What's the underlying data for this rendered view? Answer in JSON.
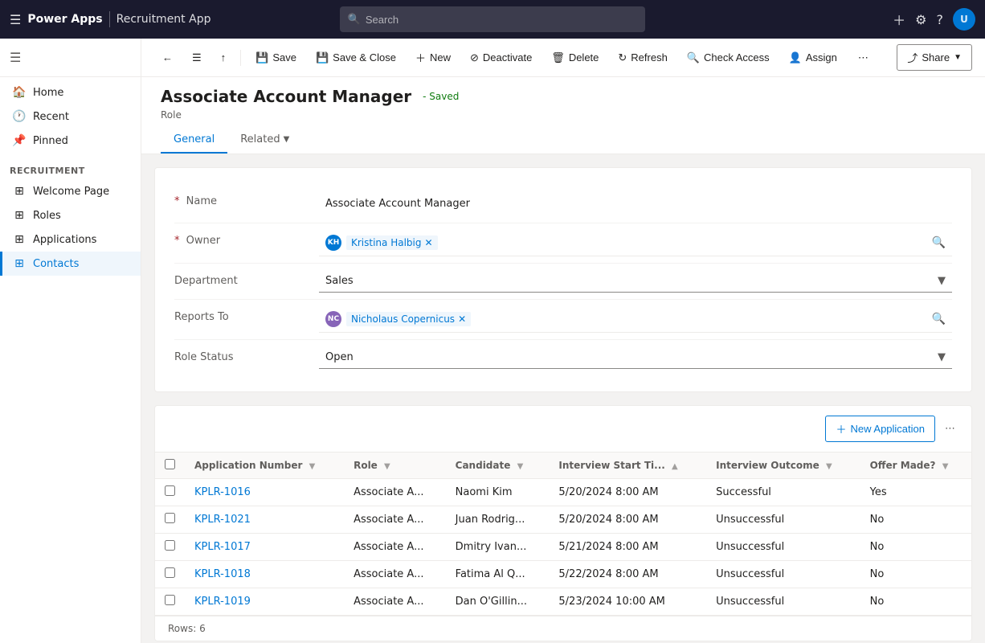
{
  "app": {
    "name": "Power Apps",
    "module": "Recruitment App"
  },
  "search": {
    "placeholder": "Search"
  },
  "topnav": {
    "icons": [
      "plus",
      "gear",
      "help",
      "user"
    ]
  },
  "sidebar": {
    "toggle_icon": "hamburger",
    "items": [
      {
        "id": "home",
        "label": "Home",
        "icon": "🏠",
        "active": false
      },
      {
        "id": "recent",
        "label": "Recent",
        "icon": "🕐",
        "active": false
      },
      {
        "id": "pinned",
        "label": "Pinned",
        "icon": "📌",
        "active": false
      },
      {
        "id": "recruitment",
        "label": "Recruitment",
        "icon": "",
        "group": true
      },
      {
        "id": "welcome-page",
        "label": "Welcome Page",
        "icon": "⊞",
        "active": false
      },
      {
        "id": "roles",
        "label": "Roles",
        "icon": "⊞",
        "active": false
      },
      {
        "id": "applications",
        "label": "Applications",
        "icon": "⊞",
        "active": false
      },
      {
        "id": "contacts",
        "label": "Contacts",
        "icon": "⊞",
        "active": true
      }
    ]
  },
  "commandbar": {
    "back_label": "",
    "toggle_label": "",
    "navigate_label": "",
    "save_label": "Save",
    "save_close_label": "Save & Close",
    "new_label": "New",
    "deactivate_label": "Deactivate",
    "delete_label": "Delete",
    "refresh_label": "Refresh",
    "check_access_label": "Check Access",
    "assign_label": "Assign",
    "more_label": "⋯",
    "share_label": "Share"
  },
  "record": {
    "title": "Associate Account Manager",
    "subtitle": "Role",
    "saved_text": "- Saved"
  },
  "tabs": {
    "general_label": "General",
    "related_label": "Related"
  },
  "form": {
    "name_label": "Name",
    "name_value": "Associate Account Manager",
    "owner_label": "Owner",
    "owner_value": "Kristina Halbig",
    "owner_initials": "KH",
    "department_label": "Department",
    "department_value": "Sales",
    "reports_to_label": "Reports To",
    "reports_to_value": "Nicholaus Copernicus",
    "reports_to_initials": "NC",
    "role_status_label": "Role Status",
    "role_status_value": "Open"
  },
  "applications_table": {
    "new_button_label": "New Application",
    "columns": [
      {
        "key": "app_number",
        "label": "Application Number"
      },
      {
        "key": "role",
        "label": "Role"
      },
      {
        "key": "candidate",
        "label": "Candidate"
      },
      {
        "key": "interview_start",
        "label": "Interview Start Ti..."
      },
      {
        "key": "interview_outcome",
        "label": "Interview Outcome"
      },
      {
        "key": "offer_made",
        "label": "Offer Made?"
      }
    ],
    "rows": [
      {
        "app_number": "KPLR-1016",
        "role": "Associate A...",
        "candidate": "Naomi Kim",
        "interview_start": "5/20/2024 8:00 AM",
        "interview_outcome": "Successful",
        "outcome_class": "badge-success",
        "offer_made": "Yes",
        "offer_class": ""
      },
      {
        "app_number": "KPLR-1021",
        "role": "Associate A...",
        "candidate": "Juan Rodrig...",
        "interview_start": "5/20/2024 8:00 AM",
        "interview_outcome": "Unsuccessful",
        "outcome_class": "badge-fail",
        "offer_made": "No",
        "offer_class": ""
      },
      {
        "app_number": "KPLR-1017",
        "role": "Associate A...",
        "candidate": "Dmitry Ivan...",
        "interview_start": "5/21/2024 8:00 AM",
        "interview_outcome": "Unsuccessful",
        "outcome_class": "badge-fail",
        "offer_made": "No",
        "offer_class": ""
      },
      {
        "app_number": "KPLR-1018",
        "role": "Associate A...",
        "candidate": "Fatima Al Q...",
        "interview_start": "5/22/2024 8:00 AM",
        "interview_outcome": "Unsuccessful",
        "outcome_class": "badge-fail",
        "offer_made": "No",
        "offer_class": ""
      },
      {
        "app_number": "KPLR-1019",
        "role": "Associate A...",
        "candidate": "Dan O'Gillin...",
        "interview_start": "5/23/2024 10:00 AM",
        "interview_outcome": "Unsuccessful",
        "outcome_class": "badge-fail",
        "offer_made": "No",
        "offer_class": ""
      }
    ],
    "rows_label": "Rows:",
    "rows_count": "6"
  }
}
